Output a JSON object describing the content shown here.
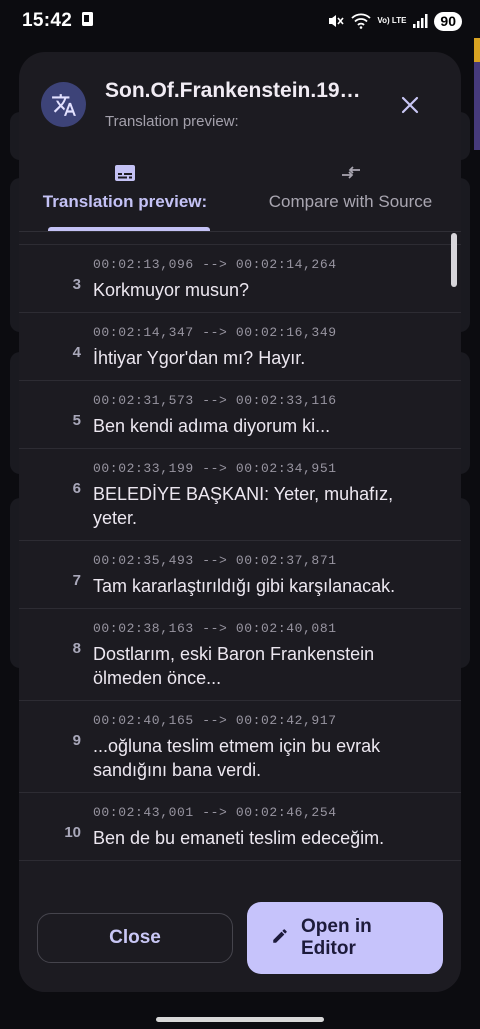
{
  "status_bar": {
    "time": "15:42",
    "network_label": "Vo) LTE",
    "battery": "90"
  },
  "dialog": {
    "title": "Son.Of.Frankenstein.19…",
    "subtitle": "Translation preview:",
    "icons": {
      "app": "translate-icon",
      "close": "close-icon"
    }
  },
  "tabs": [
    {
      "label": "Translation preview:",
      "icon": "subtitles-icon",
      "selected": true
    },
    {
      "label": "Compare with Source",
      "icon": "compare-arrows-icon",
      "selected": false
    }
  ],
  "entries": [
    {
      "num": "3",
      "time": "00:02:13,096 --> 00:02:14,264",
      "text": "Korkmuyor musun?"
    },
    {
      "num": "4",
      "time": "00:02:14,347 --> 00:02:16,349",
      "text": "İhtiyar Ygor'dan mı? Hayır."
    },
    {
      "num": "5",
      "time": "00:02:31,573 --> 00:02:33,116",
      "text": "Ben kendi adıma diyorum ki..."
    },
    {
      "num": "6",
      "time": "00:02:33,199 --> 00:02:34,951",
      "text": "BELEDİYE BAŞKANI: Yeter, muhafız, yeter."
    },
    {
      "num": "7",
      "time": "00:02:35,493 --> 00:02:37,871",
      "text": "Tam kararlaştırıldığı gibi karşılanacak."
    },
    {
      "num": "8",
      "time": "00:02:38,163 --> 00:02:40,081",
      "text": "Dostlarım, eski Baron Frankenstein ölmeden önce..."
    },
    {
      "num": "9",
      "time": "00:02:40,165 --> 00:02:42,917",
      "text": "...oğluna teslim etmem için bu evrak sandığını bana verdi."
    },
    {
      "num": "10",
      "time": "00:02:43,001 --> 00:02:46,254",
      "text": "Ben de bu emaneti teslim edeceğim."
    }
  ],
  "footer": {
    "close_label": "Close",
    "open_label": "Open in Editor",
    "open_icon": "edit-pencil-icon"
  },
  "colors": {
    "dialog_bg": "#1c1b21",
    "accent": "#c4c2f5",
    "primary_button": "#c6c3fb",
    "avatar_bg": "#3d4378"
  }
}
